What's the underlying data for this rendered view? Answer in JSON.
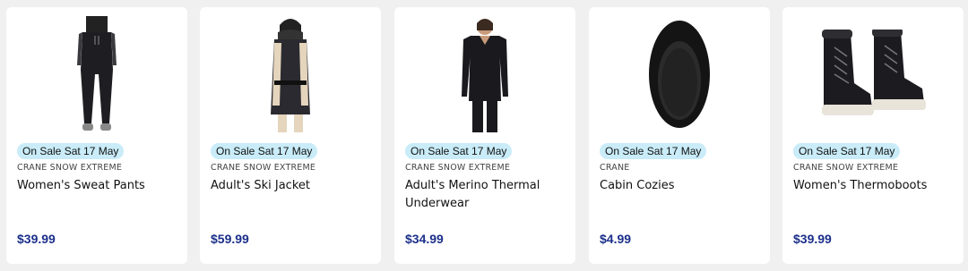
{
  "colors": {
    "badge_bg": "#c9ecf8",
    "price": "#1b2f8a",
    "card_bg": "#ffffff",
    "page_bg": "#f0f0f0"
  },
  "products": [
    {
      "image": "sweat-pants-image",
      "badge": "On Sale Sat 17 May",
      "brand": "CRANE SNOW EXTREME",
      "title": "Women's Sweat Pants",
      "price": "$39.99"
    },
    {
      "image": "ski-jacket-image",
      "badge": "On Sale Sat 17 May",
      "brand": "CRANE SNOW EXTREME",
      "title": "Adult's Ski Jacket",
      "price": "$59.99"
    },
    {
      "image": "thermal-underwear-image",
      "badge": "On Sale Sat 17 May",
      "brand": "CRANE SNOW EXTREME",
      "title": "Adult's Merino Thermal Underwear",
      "price": "$34.99"
    },
    {
      "image": "cabin-cozies-image",
      "badge": "On Sale Sat 17 May",
      "brand": "CRANE",
      "title": "Cabin Cozies",
      "price": "$4.99"
    },
    {
      "image": "thermoboots-image",
      "badge": "On Sale Sat 17 May",
      "brand": "CRANE SNOW EXTREME",
      "title": "Women's Thermoboots",
      "price": "$39.99"
    }
  ]
}
